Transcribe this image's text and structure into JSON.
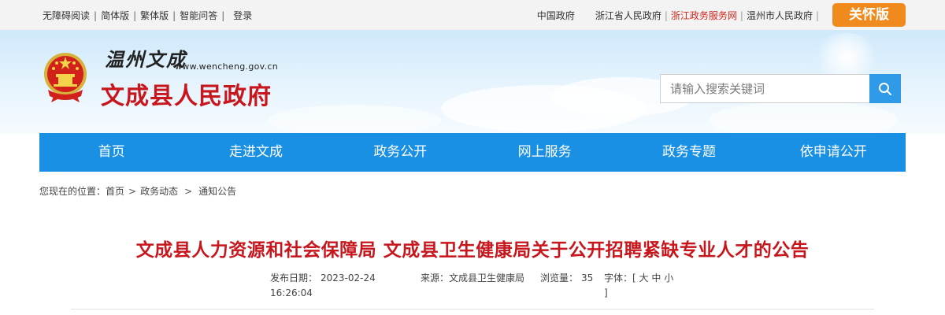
{
  "topbar": {
    "left_links": [
      "无障碍阅读",
      "简体版",
      "繁体版",
      "智能问答",
      "登录"
    ],
    "right_links": [
      "中国政府",
      "浙江省人民政府",
      "浙江政务服务网",
      "温州市人民政府"
    ],
    "care_button": "关怀版"
  },
  "header": {
    "calligraphy": "温州文成",
    "url": "www.wencheng.gov.cn",
    "title": "文成县人民政府",
    "search_placeholder": "请输入搜索关键词"
  },
  "nav": [
    "首页",
    "走进文成",
    "政务公开",
    "网上服务",
    "政务专题",
    "依申请公开"
  ],
  "breadcrumb": {
    "prefix": "您现在的位置：",
    "items": [
      "首页",
      "政务动态",
      "通知公告"
    ],
    "arrow": ">"
  },
  "article": {
    "title": "文成县人力资源和社会保障局 文成县卫生健康局关于公开招聘紧缺专业人才的公告",
    "publish_label": "发布日期：",
    "publish_date": "2023-02-24",
    "publish_time": "16:26:04",
    "source_label": "来源：",
    "source": "文成县卫生健康局",
    "views_label": "浏览量：",
    "views": "35",
    "font_label": "字体：",
    "font_open": "[",
    "font_sizes": [
      "大",
      "中",
      "小"
    ],
    "font_close": "]"
  },
  "colors": {
    "brand_red": "#c8161d",
    "nav_blue": "#1a90e4",
    "care_orange": "#f08a1d",
    "search_blue": "#2f9ae8"
  }
}
